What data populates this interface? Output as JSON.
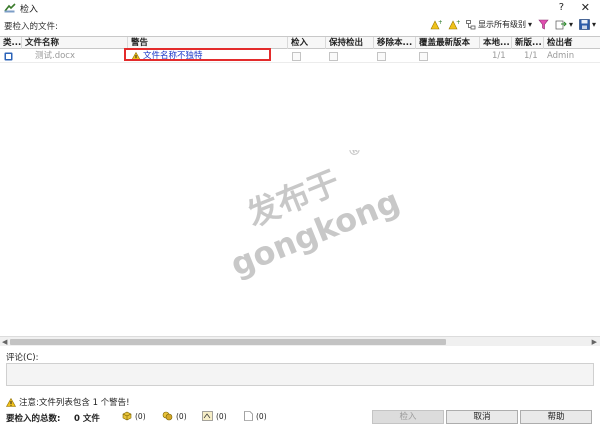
{
  "window": {
    "title": "检入",
    "help_label": "?",
    "close_label": "✕"
  },
  "toolbar": {
    "files_label": "要检入的文件:",
    "show_levels_label": "显示所有级别"
  },
  "grid": {
    "columns": [
      "类...",
      "文件名称",
      "警告",
      "检入",
      "保持检出",
      "移除本...",
      "覆盖最新版本",
      "本地...",
      "新版...",
      "检出者"
    ],
    "rows": [
      {
        "file_name": "测试.docx",
        "warning": "文件名称不独特",
        "checkin": false,
        "keep_checked_out": false,
        "remove_local": false,
        "overwrite_latest": false,
        "local_version": "1/1",
        "new_version": "1/1",
        "checked_out_by": "Admin"
      }
    ]
  },
  "watermark": {
    "line1": "发布于",
    "line2": "gongkong",
    "mark": "®"
  },
  "comment": {
    "label": "评论(C):",
    "value": ""
  },
  "notice": {
    "text": "注意:文件列表包含 1 个警告!"
  },
  "footer": {
    "total_label": "要检入的总数:",
    "total_count": "0 文件",
    "stats": [
      "(0)",
      "(0)",
      "(0)",
      "(0)",
      "(0)"
    ],
    "checkin_button": "检入",
    "cancel_button": "取消",
    "help_button": "帮助"
  },
  "colors": {
    "warning_text": "#1a37c8",
    "highlight_border": "#e32b2b",
    "watermark": "#c8c8c8"
  }
}
